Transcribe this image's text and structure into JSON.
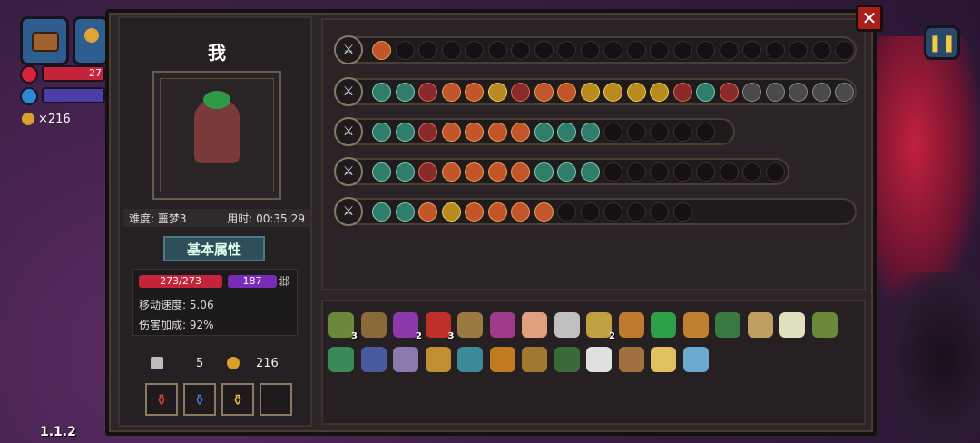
{
  "hud": {
    "hp_partial": "27",
    "coins": "×216",
    "version": "1.1.2",
    "pause_icon": "pause-icon"
  },
  "character": {
    "name": "我",
    "difficulty": "难度: 噩梦3",
    "time": "用时: 00:35:29",
    "attributes_label": "基本属性",
    "hp": "273/273",
    "mp": "187",
    "shield": "邶",
    "move_speed": "移动速度: 5.06",
    "damage_bonus": "伤害加成: 92%",
    "keys": "5",
    "gold": "216"
  },
  "potions": [
    "red-potion",
    "blue-potion",
    "yellow-potion",
    "empty"
  ],
  "weapon_rows": [
    {
      "name": "chest-weapon",
      "filled": [
        "o"
      ],
      "total": 21
    },
    {
      "name": "staff-weapon",
      "filled": [
        "f",
        "f",
        "r",
        "o",
        "o",
        "y",
        "r",
        "o",
        "o",
        "y",
        "y",
        "y",
        "y",
        "r",
        "f",
        "r",
        "g",
        "g",
        "g",
        "g",
        "g"
      ],
      "total": 21
    },
    {
      "name": "crystal-sword",
      "filled": [
        "f",
        "f",
        "r",
        "o",
        "o",
        "o",
        "o",
        "f",
        "f",
        "f"
      ],
      "total": 15
    },
    {
      "name": "golden-staff",
      "filled": [
        "f",
        "f",
        "r",
        "o",
        "o",
        "o",
        "o",
        "f",
        "f",
        "f"
      ],
      "total": 18
    },
    {
      "name": "dark-spear",
      "filled": [
        "f",
        "f",
        "o",
        "y",
        "o",
        "o",
        "o",
        "o"
      ],
      "total": 14
    }
  ],
  "items_row1": [
    {
      "icon": "hat-icon",
      "badge": "3"
    },
    {
      "icon": "fish-icon",
      "badge": ""
    },
    {
      "icon": "witch-hat-icon",
      "badge": "2"
    },
    {
      "icon": "demon-mask-icon",
      "badge": "3"
    },
    {
      "icon": "dagger-icon",
      "badge": ""
    },
    {
      "icon": "cape-icon",
      "badge": ""
    },
    {
      "icon": "pig-icon",
      "badge": ""
    },
    {
      "icon": "glasses-icon",
      "badge": ""
    },
    {
      "icon": "hourglass-icon",
      "badge": "2"
    },
    {
      "icon": "whip-icon",
      "badge": ""
    },
    {
      "icon": "clover-icon",
      "badge": ""
    },
    {
      "icon": "pickaxe-icon",
      "badge": ""
    },
    {
      "icon": "ufo-icon",
      "badge": ""
    },
    {
      "icon": "lantern-icon",
      "badge": ""
    },
    {
      "icon": "teeth-icon",
      "badge": ""
    },
    {
      "icon": "boot-icon",
      "badge": ""
    }
  ],
  "items_row2": [
    {
      "icon": "leaf-icon"
    },
    {
      "icon": "claw-icon"
    },
    {
      "icon": "rabbit-icon"
    },
    {
      "icon": "scroll-icon"
    },
    {
      "icon": "gem-icon"
    },
    {
      "icon": "cup-icon"
    },
    {
      "icon": "bird-icon"
    },
    {
      "icon": "frog-icon"
    },
    {
      "icon": "feather-icon"
    },
    {
      "icon": "card-icon"
    },
    {
      "icon": "cheese-icon"
    },
    {
      "icon": "key-icon"
    }
  ],
  "colors": {
    "hp": "#c6243a",
    "mp": "#7a2ab8",
    "panel": "#2d2629",
    "accent": "#f5c842"
  }
}
